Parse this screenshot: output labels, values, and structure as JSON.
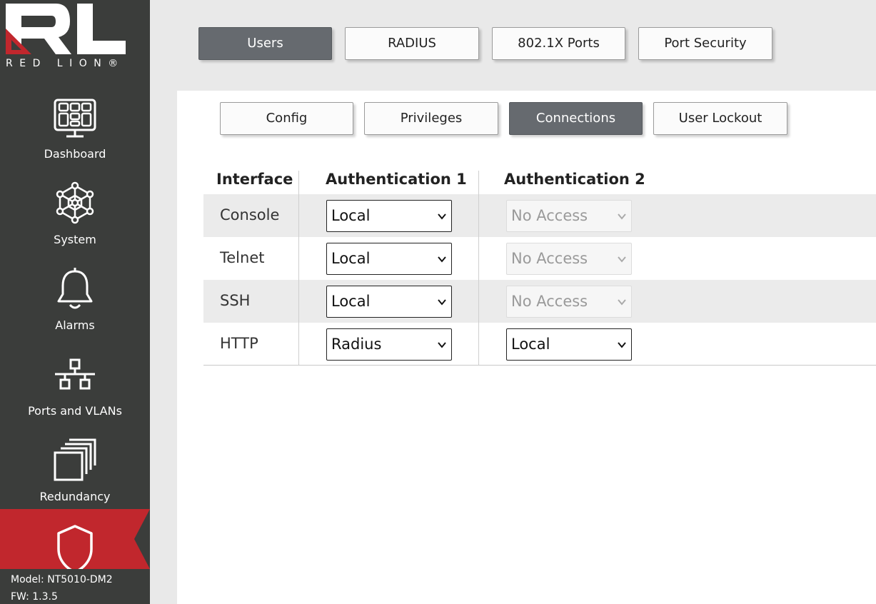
{
  "brand": {
    "logo_mark": "RL",
    "logo_text": "RED LION®",
    "accent_red": "#c1272d",
    "sidebar_bg": "#3b3d3b"
  },
  "sidebar": {
    "items": [
      {
        "label": "Dashboard",
        "icon": "dashboard-grid-icon"
      },
      {
        "label": "System",
        "icon": "network-hub-icon"
      },
      {
        "label": "Alarms",
        "icon": "bell-icon"
      },
      {
        "label": "Ports and VLANs",
        "icon": "ports-tree-icon"
      },
      {
        "label": "Redundancy",
        "icon": "stacked-windows-icon"
      },
      {
        "label": "",
        "icon": "shield-icon",
        "active": true
      }
    ],
    "model": "Model: NT5010-DM2",
    "firmware": "FW: 1.3.5"
  },
  "top_tabs": [
    {
      "label": "Users",
      "active": true
    },
    {
      "label": "RADIUS",
      "active": false
    },
    {
      "label": "802.1X Ports",
      "active": false
    },
    {
      "label": "Port Security",
      "active": false
    }
  ],
  "sub_tabs": [
    {
      "label": "Config",
      "active": false
    },
    {
      "label": "Privileges",
      "active": false
    },
    {
      "label": "Connections",
      "active": true
    },
    {
      "label": "User Lockout",
      "active": false
    }
  ],
  "table": {
    "headers": [
      "Interface",
      "Authentication 1",
      "Authentication 2"
    ],
    "rows": [
      {
        "interface": "Console",
        "auth1": "Local",
        "auth2": "No Access",
        "auth2_disabled": true
      },
      {
        "interface": "Telnet",
        "auth1": "Local",
        "auth2": "No Access",
        "auth2_disabled": true
      },
      {
        "interface": "SSH",
        "auth1": "Local",
        "auth2": "No Access",
        "auth2_disabled": true
      },
      {
        "interface": "HTTP",
        "auth1": "Radius",
        "auth2": "Local",
        "auth2_disabled": false
      }
    ]
  }
}
